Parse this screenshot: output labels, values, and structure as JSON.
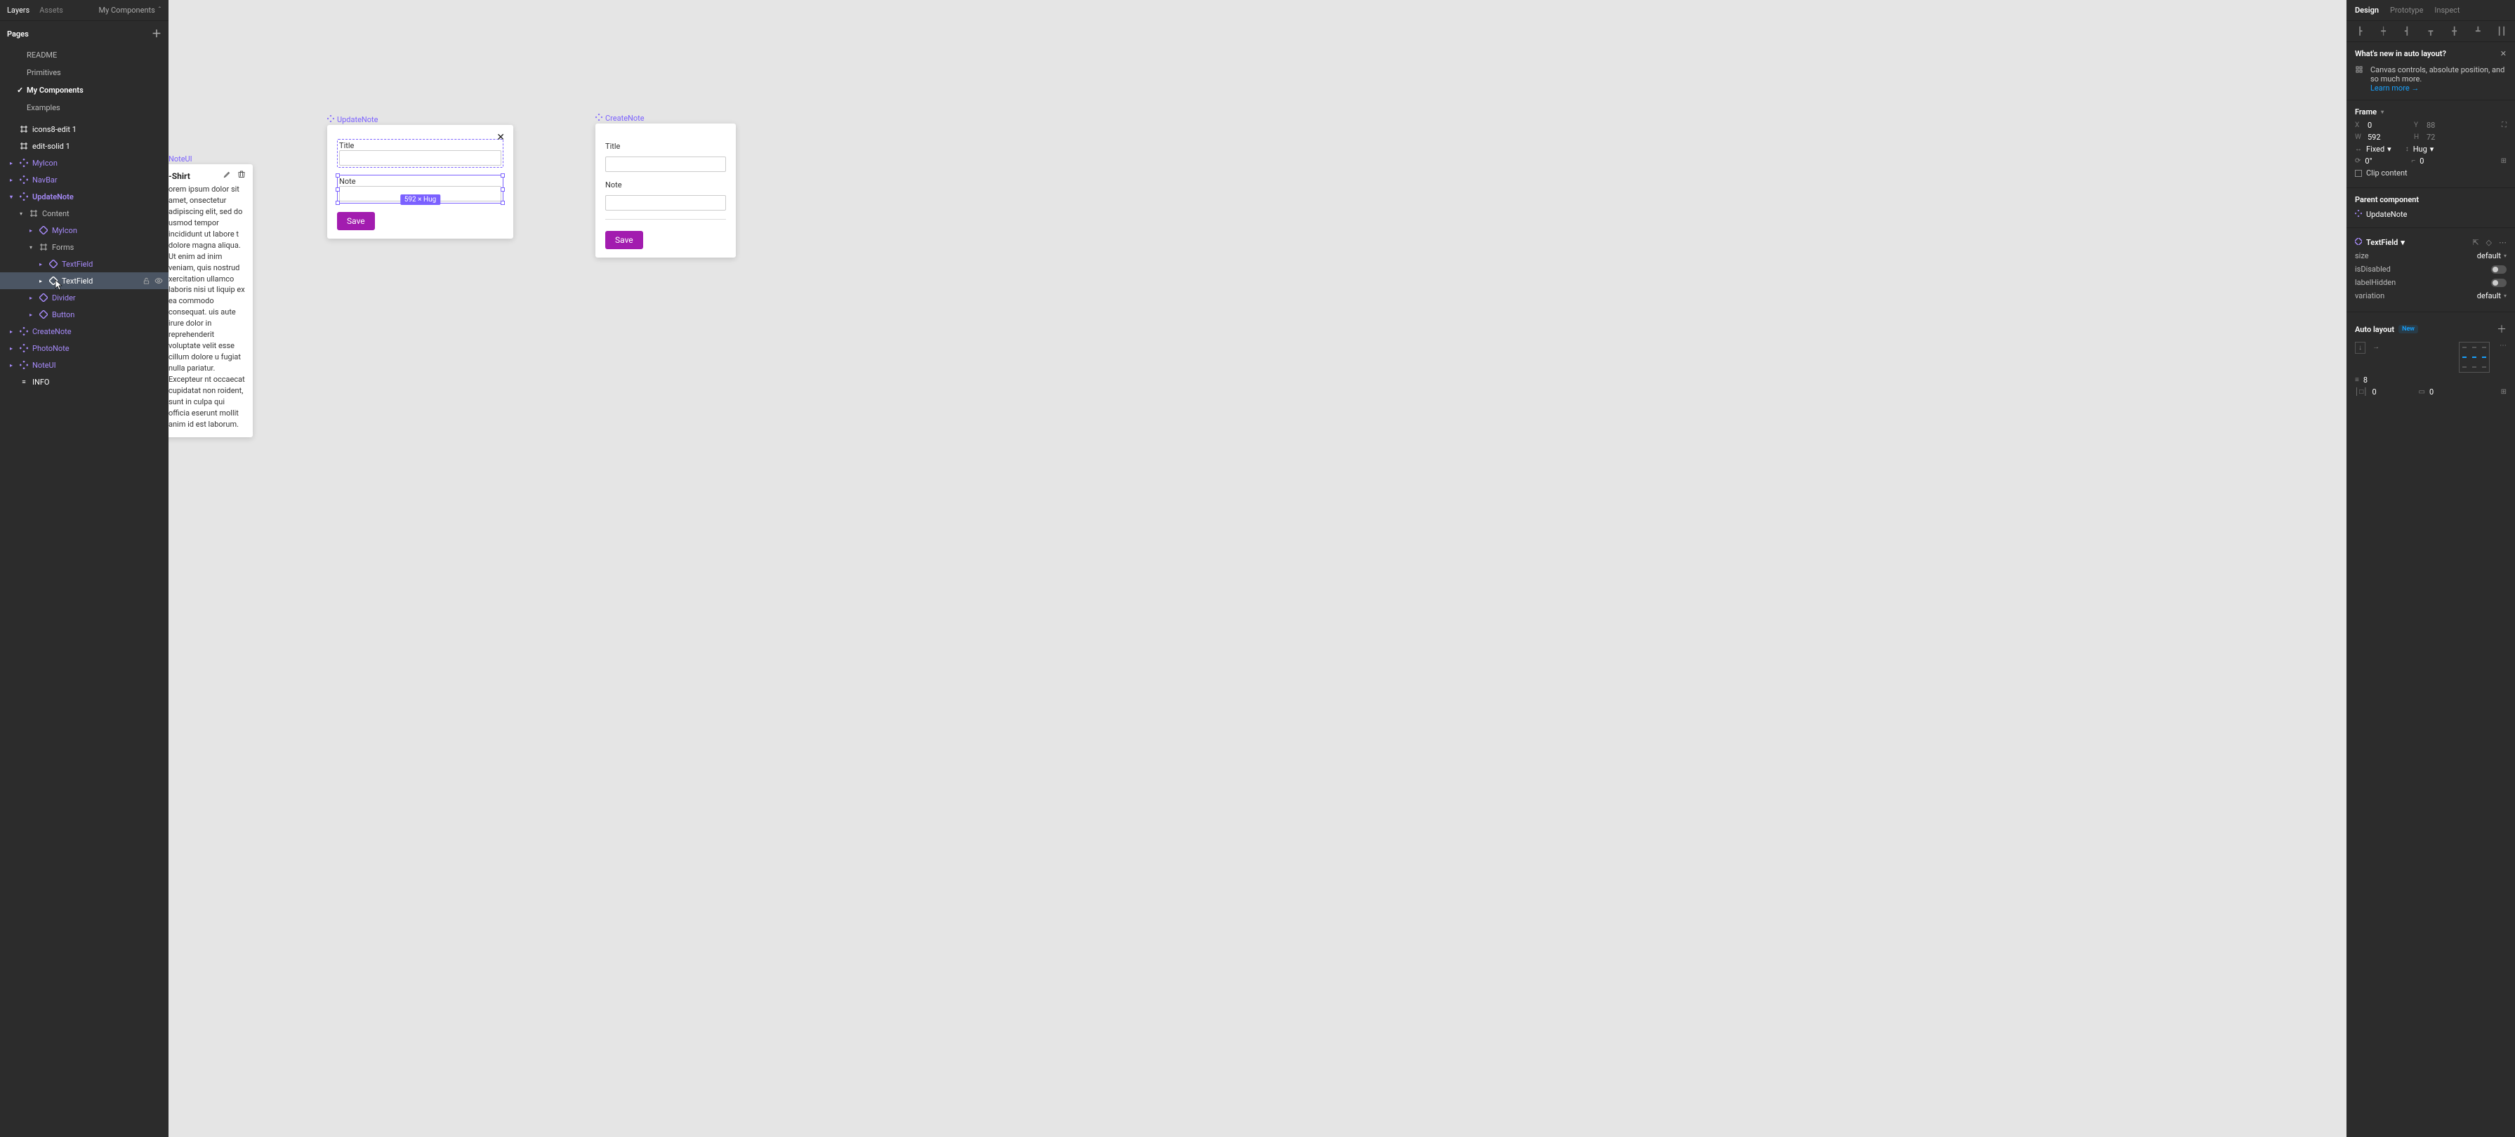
{
  "left": {
    "tabs": [
      "Layers",
      "Assets"
    ],
    "active_tab": 0,
    "page_selector": "My Components",
    "pages_header": "Pages",
    "pages": [
      {
        "name": "README",
        "active": false
      },
      {
        "name": "Primitives",
        "active": false
      },
      {
        "name": "My Components",
        "active": true,
        "caret": true
      },
      {
        "name": "Examples",
        "active": false
      }
    ],
    "layers": [
      {
        "depth": 0,
        "kind": "frame",
        "name": "icons8-edit 1",
        "white": true,
        "caret": null
      },
      {
        "depth": 0,
        "kind": "frame",
        "name": "edit-solid 1",
        "white": true,
        "caret": null
      },
      {
        "depth": 0,
        "kind": "comp",
        "name": "MyIcon",
        "caret": "r"
      },
      {
        "depth": 0,
        "kind": "comp",
        "name": "NavBar",
        "caret": "r"
      },
      {
        "depth": 0,
        "kind": "comp",
        "name": "UpdateNote",
        "caret": "d",
        "bold": true
      },
      {
        "depth": 1,
        "kind": "frame",
        "name": "Content",
        "caret": "d",
        "grey": true
      },
      {
        "depth": 2,
        "kind": "inst",
        "name": "MyIcon",
        "caret": "r"
      },
      {
        "depth": 2,
        "kind": "frame",
        "name": "Forms",
        "caret": "d",
        "grey": true
      },
      {
        "depth": 3,
        "kind": "inst",
        "name": "TextField",
        "caret": "r"
      },
      {
        "depth": 3,
        "kind": "inst",
        "name": "TextField",
        "caret": "r",
        "selected": true,
        "actions": true
      },
      {
        "depth": 2,
        "kind": "inst",
        "name": "Divider",
        "caret": "r"
      },
      {
        "depth": 2,
        "kind": "inst",
        "name": "Button",
        "caret": "r"
      },
      {
        "depth": 0,
        "kind": "comp",
        "name": "CreateNote",
        "caret": "r"
      },
      {
        "depth": 0,
        "kind": "comp",
        "name": "PhotoNote",
        "caret": "r"
      },
      {
        "depth": 0,
        "kind": "comp",
        "name": "NoteUI",
        "caret": "r"
      },
      {
        "depth": 0,
        "kind": "text",
        "name": "INFO",
        "white": true
      }
    ]
  },
  "canvas": {
    "noteui": {
      "label": "NoteUI",
      "title": "-Shirt",
      "body": "orem ipsum dolor sit amet, onsectetur adipiscing elit, sed do usmod tempor incididunt ut labore t dolore magna aliqua. Ut enim ad inim veniam, quis nostrud xercitation ullamco laboris nisi ut liquip ex ea commodo consequat. uis aute irure dolor in reprehenderit voluptate velit esse cillum dolore u fugiat nulla pariatur. Excepteur nt occaecat cupidatat non roident, sunt in culpa qui officia eserunt mollit anim id est laborum."
    },
    "update": {
      "label": "UpdateNote",
      "title_label": "Title",
      "note_label": "Note",
      "save": "Save",
      "dim": "592 × Hug"
    },
    "create": {
      "label": "CreateNote",
      "title_label": "Title",
      "note_label": "Note",
      "save": "Save"
    }
  },
  "right": {
    "tabs": [
      "Design",
      "Prototype",
      "Inspect"
    ],
    "active_tab": 0,
    "whatsnew": {
      "title": "What's new in auto layout?",
      "body": "Canvas controls, absolute position, and so much more.",
      "link": "Learn more →"
    },
    "frame": {
      "header": "Frame",
      "x_label": "X",
      "x": "0",
      "y_label": "Y",
      "y": "88",
      "w_label": "W",
      "w": "592",
      "h_label": "H",
      "h": "72",
      "wmode": "Fixed",
      "hmode": "Hug",
      "angle": "0°",
      "radius": "0",
      "clip": "Clip content"
    },
    "parent": {
      "header": "Parent component",
      "name": "UpdateNote"
    },
    "inst": {
      "name": "TextField",
      "props": [
        {
          "k": "size",
          "v": "default",
          "type": "sel"
        },
        {
          "k": "isDisabled",
          "type": "toggle"
        },
        {
          "k": "labelHidden",
          "type": "toggle"
        },
        {
          "k": "variation",
          "v": "default",
          "type": "sel"
        }
      ]
    },
    "autolayout": {
      "header": "Auto layout",
      "new": "New",
      "gap": "8",
      "padH": "0",
      "padV": "0"
    }
  }
}
